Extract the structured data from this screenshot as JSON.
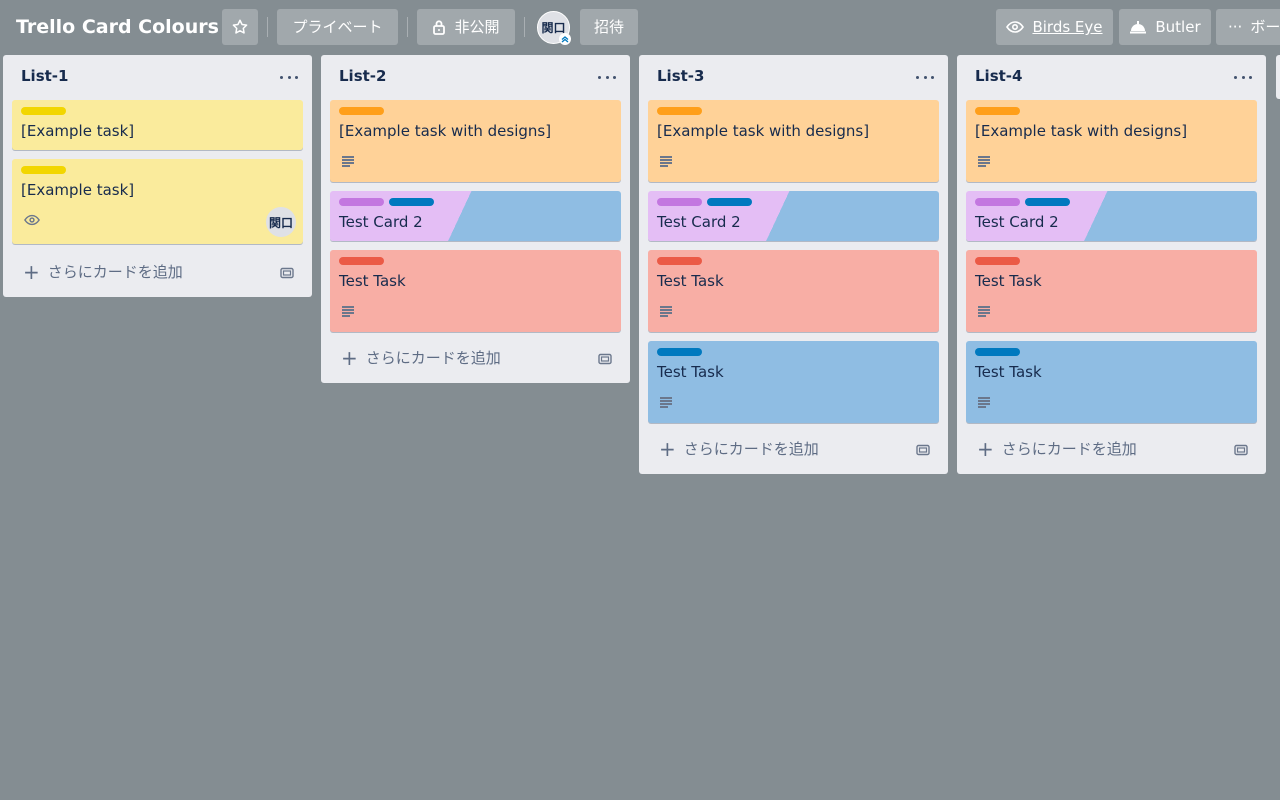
{
  "header": {
    "board_title": "Trello Card Colours",
    "visibility_label": "プライベート",
    "privacy_label": "非公開",
    "avatar_initials": "関口",
    "invite_label": "招待",
    "birds_eye_label": "Birds Eye",
    "butler_label": "Butler",
    "board_menu_label": "ボー"
  },
  "add_card_label": "さらにカードを追加",
  "colors": {
    "board_bg": "#848d92",
    "yellow_card": "#faeb9c",
    "yellow_label": "#f2d600",
    "orange_card": "#ffd298",
    "orange_label": "#ff9f1a",
    "red_card": "#f8aea5",
    "red_label": "#eb5a46",
    "purple_card": "#e4bef5",
    "purple_label": "#c377e0",
    "blue_card": "#8fbde3",
    "blue_label": "#0079bf"
  },
  "lists": [
    {
      "title": "List-1",
      "cards": [
        {
          "title": "[Example task]",
          "labels": [
            "yellow"
          ]
        },
        {
          "title": "[Example task]",
          "labels": [
            "yellow"
          ],
          "watch_icon": "eye-icon",
          "member": "関口"
        }
      ]
    },
    {
      "title": "List-2",
      "cards": [
        {
          "title": "[Example task with designs]",
          "labels": [
            "orange"
          ],
          "badge": "description-icon"
        },
        {
          "title": "Test Card 2",
          "labels": [
            "purple",
            "blue"
          ]
        },
        {
          "title": "Test Task",
          "labels": [
            "red"
          ],
          "badge": "description-icon"
        }
      ]
    },
    {
      "title": "List-3",
      "cards": [
        {
          "title": "[Example task with designs]",
          "labels": [
            "orange"
          ],
          "badge": "description-icon"
        },
        {
          "title": "Test Card 2",
          "labels": [
            "purple",
            "blue"
          ]
        },
        {
          "title": "Test Task",
          "labels": [
            "red"
          ],
          "badge": "description-icon"
        },
        {
          "title": "Test Task",
          "labels": [
            "blue"
          ],
          "badge": "description-icon"
        }
      ]
    },
    {
      "title": "List-4",
      "cards": [
        {
          "title": "[Example task with designs]",
          "labels": [
            "orange"
          ],
          "badge": "description-icon"
        },
        {
          "title": "Test Card 2",
          "labels": [
            "purple",
            "blue"
          ]
        },
        {
          "title": "Test Task",
          "labels": [
            "red"
          ],
          "badge": "description-icon"
        },
        {
          "title": "Test Task",
          "labels": [
            "blue"
          ],
          "badge": "description-icon"
        }
      ]
    }
  ]
}
